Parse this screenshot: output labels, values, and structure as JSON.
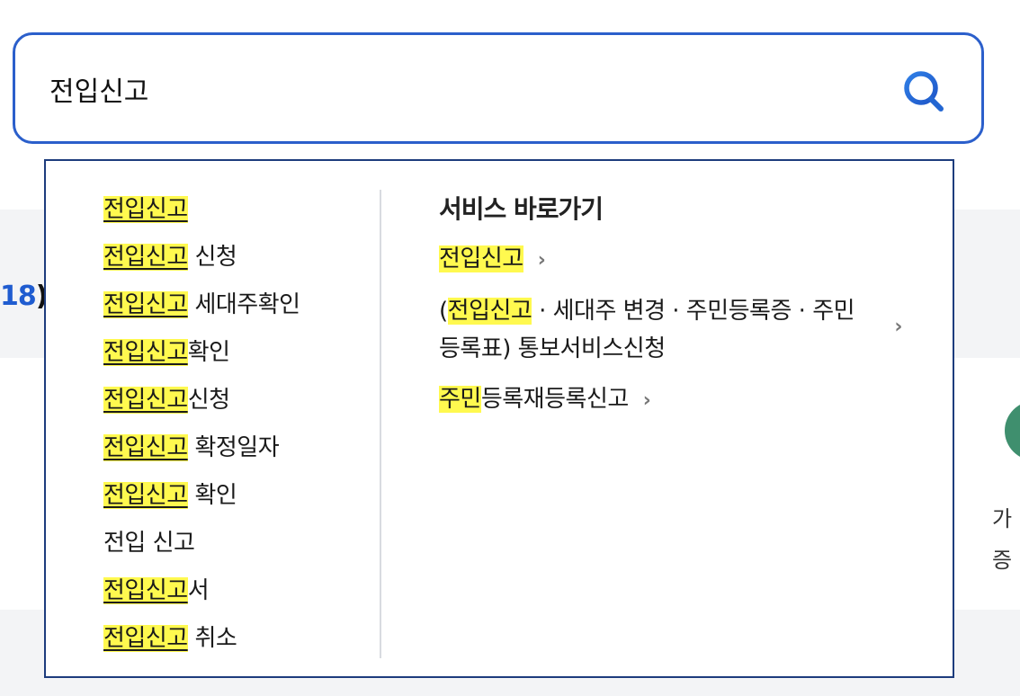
{
  "search": {
    "value": "전입신고",
    "button_label": "검색"
  },
  "background": {
    "peek_number": "18",
    "peek_paren": ")",
    "peek_text_1": "가",
    "peek_text_2": "증"
  },
  "suggestions": [
    {
      "hl": "전입신고",
      "rest": ""
    },
    {
      "hl": "전입신고",
      "rest": " 신청"
    },
    {
      "hl": "전입신고",
      "rest": " 세대주확인"
    },
    {
      "hl": "전입신고",
      "rest": "확인"
    },
    {
      "hl": "전입신고",
      "rest": "신청"
    },
    {
      "hl": "전입신고",
      "rest": " 확정일자"
    },
    {
      "hl": "전입신고",
      "rest": " 확인"
    },
    {
      "hl": "",
      "rest": "전입 신고"
    },
    {
      "hl": "전입신고",
      "rest": "서"
    },
    {
      "hl": "전입신고",
      "rest": " 취소"
    }
  ],
  "services": {
    "title": "서비스 바로가기",
    "links": [
      {
        "pre": "",
        "hl": "전입신고",
        "post": ""
      },
      {
        "pre": "(",
        "hl": "전입신고",
        "post": " · 세대주 변경 · 주민등록증 · 주민등록표) 통보서비스신청"
      },
      {
        "pre": "",
        "hl": "주민",
        "post": "등록재등록신고"
      }
    ],
    "chevron": "›"
  },
  "colors": {
    "accent": "#2b5fcb",
    "highlight": "#fff94f",
    "dropdown_border": "#1d3c7d"
  }
}
